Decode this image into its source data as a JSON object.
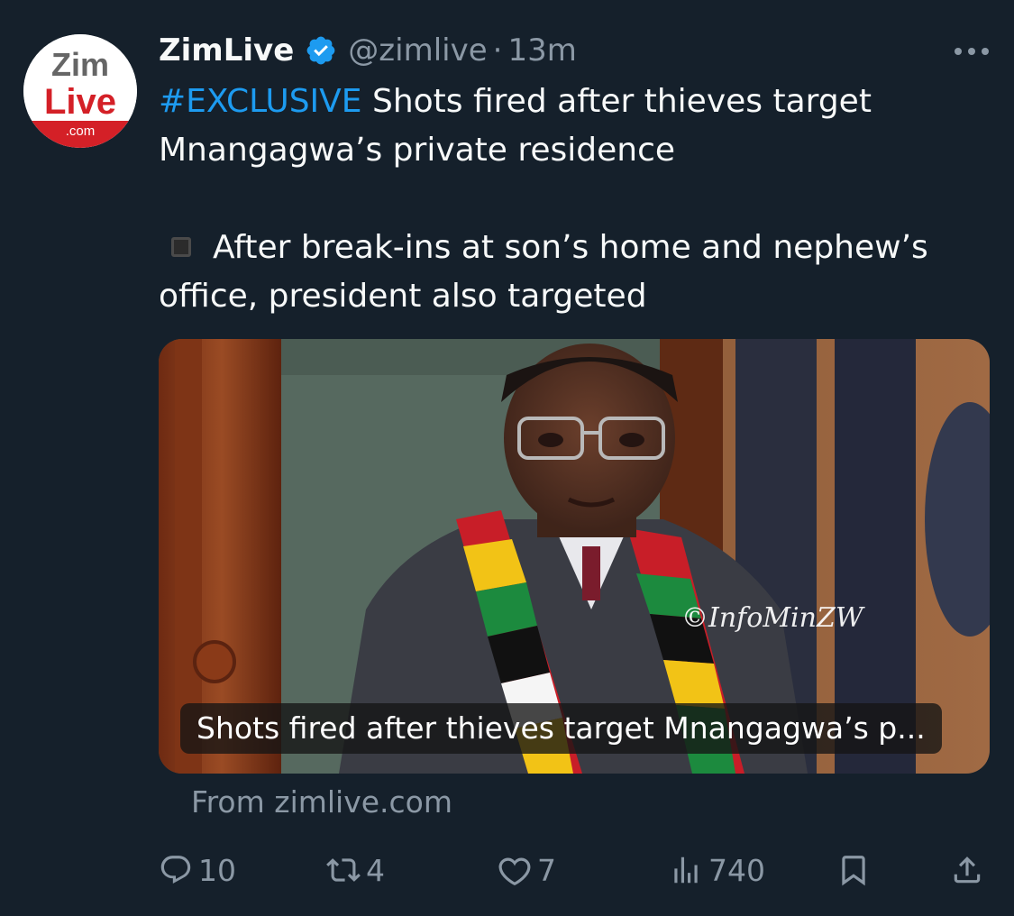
{
  "account": {
    "display_name": "ZimLive",
    "handle": "@zimlive",
    "separator": "·",
    "time": "13m",
    "avatar": {
      "line1": "Zim",
      "line2": "Live",
      "line3": ".com"
    },
    "verified_icon": "verified-badge-icon",
    "colors": {
      "verified": "#1d9bf0",
      "brand_red": "#d42027"
    }
  },
  "tweet": {
    "hashtag": "#EXCLUSIVE",
    "headline": " Shots fired after thieves target Mnangagwa’s private residence",
    "bullet_icon": "black-square-icon",
    "subline": "After break-ins at son’s home and nephew’s office, president also targeted"
  },
  "card": {
    "watermark": "©InfoMinZW",
    "caption": "Shots fired after thieves target Mnangagwa’s p...",
    "source": "From zimlive.com"
  },
  "actions": {
    "replies": "10",
    "reposts": "4",
    "likes": "7",
    "views": "740",
    "icons": [
      "reply-icon",
      "repost-icon",
      "like-icon",
      "views-icon",
      "bookmark-icon",
      "share-icon"
    ]
  },
  "colors": {
    "background": "#15202b",
    "text": "#f7f9f9",
    "secondary": "#8b98a5",
    "link": "#1d9bf0"
  }
}
